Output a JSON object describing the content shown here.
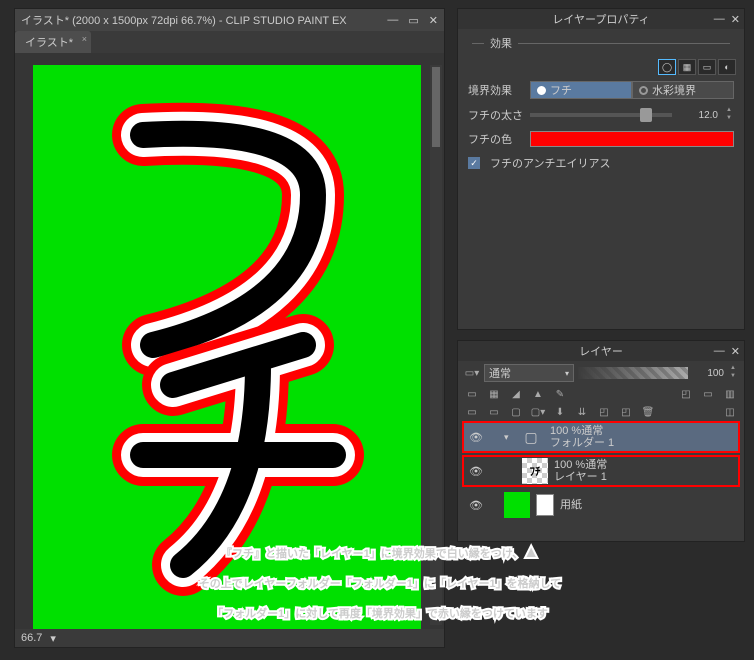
{
  "window": {
    "title": "イラスト* (2000 x 1500px 72dpi 66.7%)  - CLIP STUDIO PAINT EX",
    "tab": "イラスト*",
    "zoom": "66.7"
  },
  "layer_property": {
    "panel_title": "レイヤープロパティ",
    "section_effect": "効果",
    "border_effect_label": "境界効果",
    "border_option_1": "フチ",
    "border_option_2": "水彩境界",
    "border_thickness_label": "フチの太さ",
    "border_thickness_value": "12.0",
    "border_color_label": "フチの色",
    "border_color": "#ff0000",
    "antialias_label": "フチのアンチエイリアス",
    "antialias_checked": true
  },
  "layer_panel": {
    "panel_title": "レイヤー",
    "blend_mode": "通常",
    "opacity": "100",
    "layers": [
      {
        "visible": true,
        "type": "folder",
        "opacity_label": "100 %通常",
        "name": "フォルダー 1",
        "selected": true,
        "highlighted": true,
        "expanded": true
      },
      {
        "visible": true,
        "type": "raster",
        "opacity_label": "100 %通常",
        "name": "レイヤー 1",
        "highlighted": true,
        "indent": 1
      },
      {
        "visible": true,
        "type": "paper",
        "opacity_label": "",
        "name": "用紙"
      }
    ]
  },
  "annotation": {
    "line1": "『フチ』と描いた「レイヤー1」に境界効果で白い縁をつけ、",
    "line2": "その上でレイヤーフォルダー「フォルダー1」に「レイヤー1」を格納して",
    "line3": "「フォルダー1」に対して再度「境界効果」で赤い縁をつけています"
  }
}
